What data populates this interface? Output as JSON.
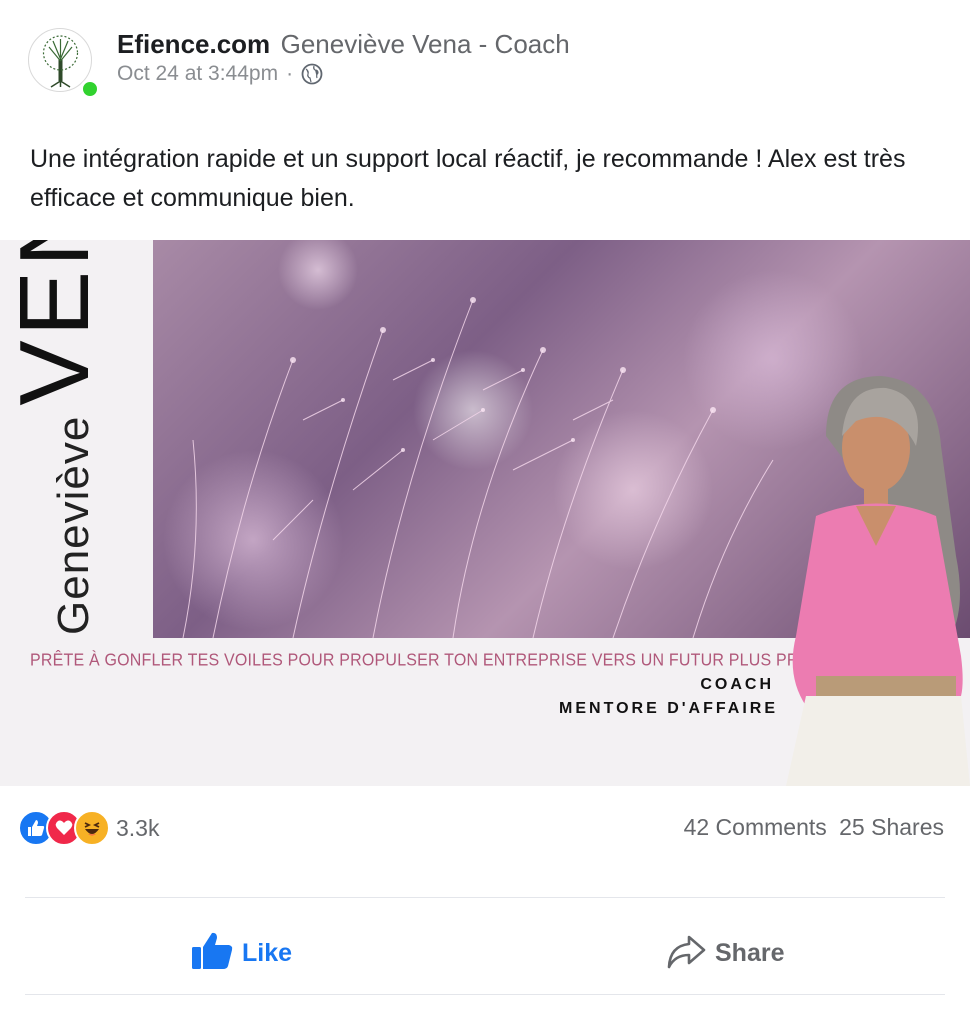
{
  "post": {
    "page_name": "Efience.com",
    "author_name": "Geneviève Vena - Coach",
    "timestamp": "Oct 24 at 3:44pm",
    "separator": "·",
    "audience_icon": "globe-icon",
    "text": "Une intégration rapide et un support local réactif, je recommande ! Alex est très efficace et communique bien."
  },
  "image": {
    "first_name": "Geneviève",
    "last_name": "VENA",
    "tagline": "PRÊTE À GONFLER TES VOILES POUR PROPULSER TON ENTREPRISE VERS  UN FUTUR PLUS PROSPÈRE ?",
    "role1": "COACH",
    "role2": "MENTORE D'AFFAIRE"
  },
  "stats": {
    "reaction_icons": [
      "like-icon",
      "love-icon",
      "haha-icon"
    ],
    "reaction_count": "3.3k",
    "comments": "42 Comments",
    "shares": "25 Shares"
  },
  "actions": {
    "like_label": "Like",
    "share_label": "Share"
  },
  "colors": {
    "accent": "#1877f2",
    "online": "#31d22f",
    "tagline": "#b0587a"
  }
}
